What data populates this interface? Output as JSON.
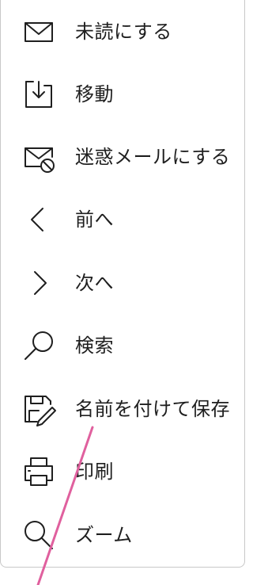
{
  "menu": {
    "items": [
      {
        "label": "未読にする",
        "icon": "mail-unread-icon"
      },
      {
        "label": "移動",
        "icon": "move-to-folder-icon"
      },
      {
        "label": "迷惑メールにする",
        "icon": "junk-mail-icon"
      },
      {
        "label": "前へ",
        "icon": "chevron-left-icon"
      },
      {
        "label": "次へ",
        "icon": "chevron-right-icon"
      },
      {
        "label": "検索",
        "icon": "search-icon"
      },
      {
        "label": "名前を付けて保存",
        "icon": "save-as-icon"
      },
      {
        "label": "印刷",
        "icon": "print-icon"
      },
      {
        "label": "ズーム",
        "icon": "zoom-icon"
      }
    ]
  },
  "colors": {
    "text": "#1f1f1f",
    "border": "#c8c8c8",
    "annotation_line": "#e0609e"
  }
}
